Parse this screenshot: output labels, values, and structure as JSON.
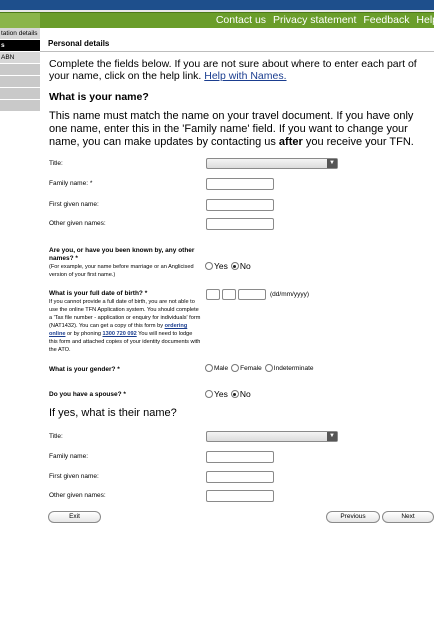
{
  "header": {
    "links": [
      "Contact us",
      "Privacy statement",
      "Feedback",
      "Help"
    ]
  },
  "sidebar": {
    "items": [
      {
        "label": "tation details",
        "state": "normal"
      },
      {
        "label": "s",
        "state": "active"
      },
      {
        "label": "ABN",
        "state": "normal"
      },
      {
        "label": "",
        "state": "blank"
      },
      {
        "label": "",
        "state": "blank"
      },
      {
        "label": "",
        "state": "blank"
      },
      {
        "label": "",
        "state": "blank"
      }
    ]
  },
  "section": {
    "title": "Personal details"
  },
  "intro": {
    "text": "Complete the fields below. If you are not sure about where to enter each part of your name, click on the help link.",
    "help_link": "Help with Names."
  },
  "name_section": {
    "heading": "What is your name?",
    "para_before": "This name must match the name on your travel document. If you have only one name, enter this in the 'Family name' field. If you want to change your name, you can make updates by contacting us ",
    "para_bold": "after",
    "para_after": " you receive your TFN."
  },
  "fields": {
    "title_label": "Title:",
    "family_label": "Family name: *",
    "first_label": "First given name:",
    "other_label": "Other given names:"
  },
  "other_names": {
    "question": "Are you, or have you been known by, any other names? *",
    "hint": "(For example, your name before marriage or an Anglicised version of your first name.)",
    "options": [
      "Yes",
      "No"
    ],
    "selected": "No"
  },
  "dob": {
    "question": "What is your full date of birth? *",
    "hint_1": "If you cannot provide a full date of birth, you are not able to use the online TFN Application system. You should complete a 'Tax file number - application or enquiry for individuals' form (NAT1432). You can get a copy of this form by ",
    "hint_link": "ordering online",
    "hint_2": " or by phoning ",
    "hint_phone": "1300 720 092",
    "hint_3": " You will need to lodge this form and attached copies of your identity documents with the ATO.",
    "format": "(dd/mm/yyyy)"
  },
  "gender": {
    "question": "What is your gender? *",
    "options": [
      "Male",
      "Female",
      "Indeterminate"
    ]
  },
  "spouse": {
    "question": "Do you have a spouse? *",
    "options": [
      "Yes",
      "No"
    ],
    "selected": "No",
    "heading": "If yes, what is their name?",
    "title_label": "Title:",
    "family_label": "Family name:",
    "first_label": "First given name:",
    "other_label": "Other given names:"
  },
  "buttons": {
    "exit": "Exit",
    "previous": "Previous",
    "next": "Next"
  }
}
